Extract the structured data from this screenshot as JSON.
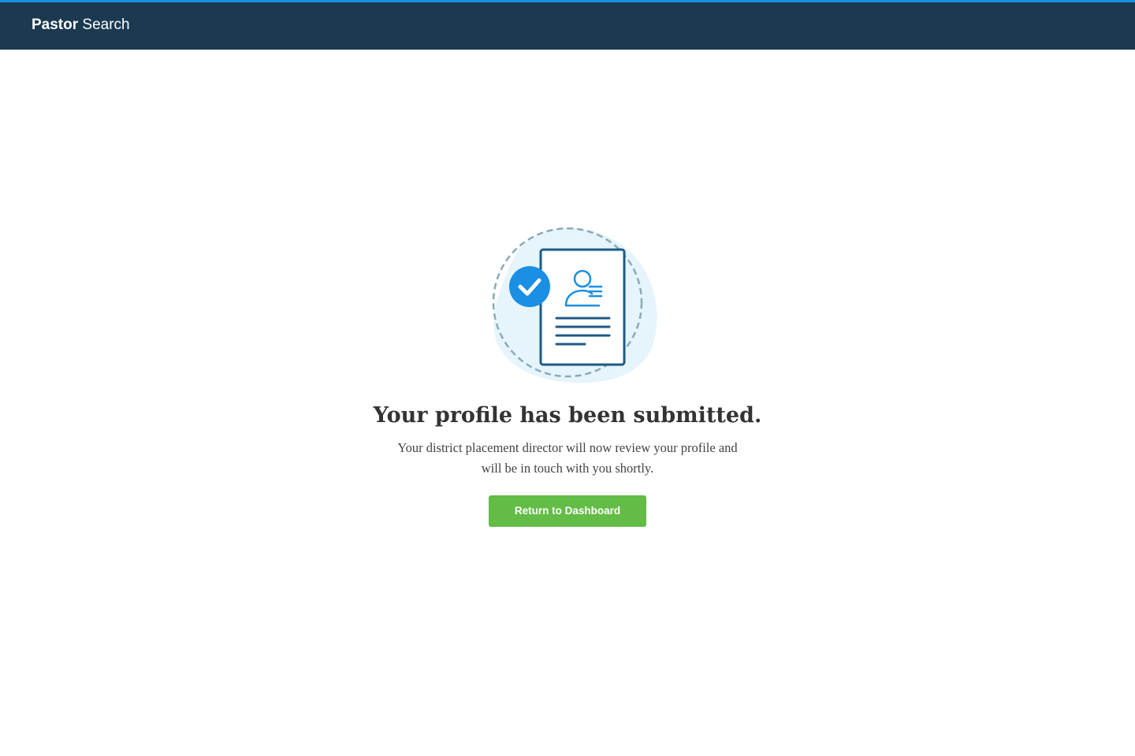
{
  "header": {
    "brand_bold": "Pastor",
    "brand_light": "Search"
  },
  "main": {
    "title": "Your profile has been submitted.",
    "description": "Your district placement director will now review your profile and will be in touch with you shortly.",
    "button_label": "Return to Dashboard"
  },
  "colors": {
    "header_bg": "#1b3a50",
    "header_accent": "#1a8fe3",
    "button_bg": "#63bc46",
    "check_badge": "#1a8fe3",
    "document_stroke": "#1e5a85",
    "illustration_blob": "#e6f4fc"
  },
  "icons": {
    "illustration": "submitted-document-illustration",
    "check": "check-circle-icon",
    "person": "person-icon"
  }
}
